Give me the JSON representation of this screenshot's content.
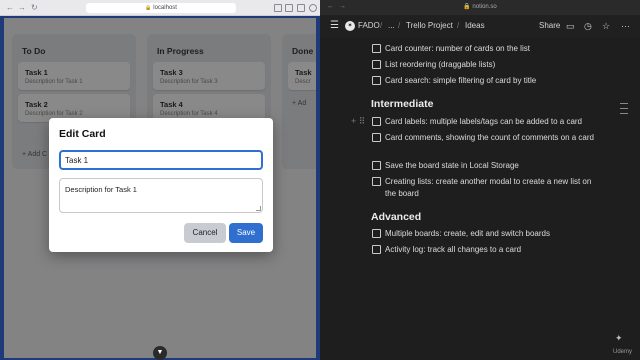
{
  "left_browser": {
    "url": "localhost",
    "nav_back": "←",
    "nav_forward": "→",
    "nav_reload": "↻"
  },
  "board": {
    "columns": [
      {
        "title": "To Do",
        "cards": [
          {
            "title": "Task 1",
            "desc": "Description for Task 1"
          },
          {
            "title": "Task 2",
            "desc": "Description for Task 2"
          }
        ],
        "add": "+ Add C"
      },
      {
        "title": "In Progress",
        "cards": [
          {
            "title": "Task 3",
            "desc": "Description for Task 3"
          },
          {
            "title": "Task 4",
            "desc": "Description for Task 4"
          }
        ]
      },
      {
        "title": "Done",
        "cards": [
          {
            "title": "Task",
            "desc": "Descr"
          }
        ],
        "add": "+ Ad"
      }
    ]
  },
  "modal": {
    "title": "Edit Card",
    "title_value": "Task 1",
    "description_value": "Description for Task 1",
    "cancel": "Cancel",
    "save": "Save",
    "colors": {
      "primary": "#2f6fd0",
      "secondary": "#c8ccd2"
    }
  },
  "notion": {
    "url": "notion.so",
    "workspace": "FADO",
    "ellipsis": "...",
    "page_parent": "Trello Project",
    "page": "Ideas",
    "share": "Share",
    "todos_top": [
      "Card counter: number of cards on the list",
      "List reordering (draggable lists)",
      "Card search: simple filtering of card by title"
    ],
    "intermediate_heading": "Intermediate",
    "todos_intermediate": [
      "Card labels: multiple labels/tags can be added to a card",
      "Card comments, showing the count of comments on a card",
      "Save the board state in Local Storage",
      "Creating lists: create another modal to create a new list on the board"
    ],
    "advanced_heading": "Advanced",
    "todos_advanced": [
      "Multiple boards: create, edit and switch boards",
      "Activity log: track all changes to a card"
    ]
  },
  "watermark": "Udemy"
}
